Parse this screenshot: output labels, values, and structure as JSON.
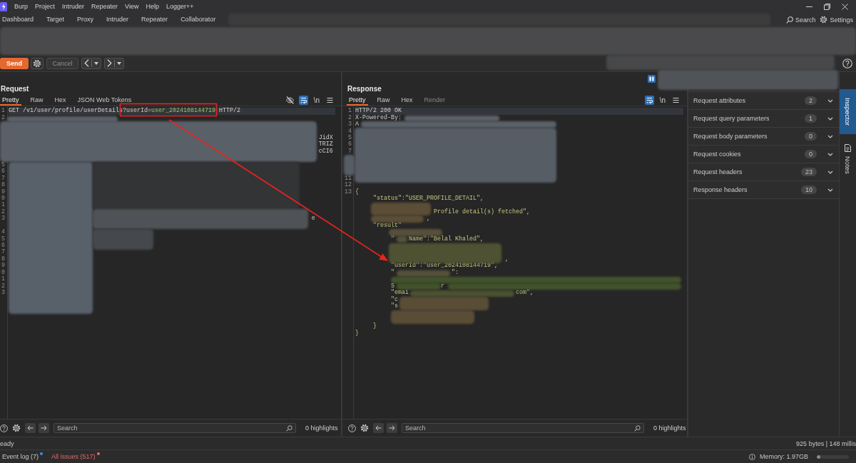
{
  "menu_bar": {
    "items": [
      "Burp",
      "Project",
      "Intruder",
      "Repeater",
      "View",
      "Help",
      "Logger++"
    ]
  },
  "nav": {
    "tabs": [
      {
        "label": "Dashboard",
        "selected": false
      },
      {
        "label": "Target",
        "selected": false
      },
      {
        "label": "Proxy",
        "selected": false
      },
      {
        "label": "Intruder",
        "selected": false
      },
      {
        "label": "Repeater",
        "selected": false
      },
      {
        "label": "Collaborator",
        "selected": false
      }
    ],
    "search": "Search",
    "settings": "Settings"
  },
  "toolbar": {
    "send": "Send",
    "cancel": {
      "label": "Cancel",
      "disabled": true
    }
  },
  "request": {
    "title": "Request",
    "tabs": [
      {
        "label": "Pretty",
        "selected": true,
        "disabled": false
      },
      {
        "label": "Raw",
        "selected": false,
        "disabled": false
      },
      {
        "label": "Hex",
        "selected": false,
        "disabled": false
      },
      {
        "label": "JSON Web Tokens",
        "selected": false,
        "disabled": false
      }
    ],
    "view_buttons": [
      {
        "kind": "hide",
        "on": false
      },
      {
        "kind": "wrap",
        "on": true
      },
      {
        "kind": "text",
        "label": "\\n",
        "on": false
      },
      {
        "kind": "menu",
        "on": false
      }
    ],
    "lines": [
      {
        "number": "1",
        "current": true,
        "segments": [
          {
            "kind": "plain",
            "text": "GET /v1/user/profile/userDetails"
          },
          {
            "kind": "param",
            "text": "?userId="
          },
          {
            "kind": "value",
            "text": "user_2024108144719"
          },
          {
            "kind": "plain",
            "text": " HTTP/2"
          }
        ]
      },
      {
        "number": "2",
        "current": false
      },
      {
        "current": false
      },
      {
        "current": false
      },
      {
        "current": false,
        "segments": [
          {
            "kind": "plain",
            "text": "                                                                                       JidX"
          }
        ]
      },
      {
        "current": false,
        "segments": [
          {
            "kind": "plain",
            "text": "                                                                                       TRIZ"
          }
        ]
      },
      {
        "current": false,
        "segments": [
          {
            "kind": "plain",
            "text": "                                                                                       cCI6"
          }
        ]
      },
      {
        "current": false
      },
      {
        "number": "5",
        "current": false
      },
      {
        "number": "6",
        "current": false
      },
      {
        "number": "7",
        "current": false
      },
      {
        "number": "8",
        "current": false
      },
      {
        "number": "9",
        "current": false
      },
      {
        "number": "0",
        "current": false
      },
      {
        "number": "1",
        "current": false
      },
      {
        "number": "2",
        "current": false
      },
      {
        "number": "3",
        "current": false,
        "segments": [
          {
            "kind": "plain",
            "text": "                                                                                     e"
          }
        ]
      },
      {
        "current": false
      },
      {
        "number": "4",
        "current": false
      },
      {
        "number": "5",
        "current": false
      },
      {
        "number": "6",
        "current": false
      },
      {
        "number": "7",
        "current": false
      },
      {
        "number": "8",
        "current": false
      },
      {
        "number": "9",
        "current": false
      },
      {
        "number": "0",
        "current": false
      },
      {
        "number": "1",
        "current": false
      },
      {
        "number": "2",
        "current": false
      },
      {
        "number": "3",
        "current": false
      }
    ],
    "search": {
      "placeholder": "Search"
    },
    "highlights": "0 highlights"
  },
  "response": {
    "title": "Response",
    "tabs": [
      {
        "label": "Pretty",
        "selected": true,
        "disabled": false
      },
      {
        "label": "Raw",
        "selected": false,
        "disabled": false
      },
      {
        "label": "Hex",
        "selected": false,
        "disabled": false
      },
      {
        "label": "Render",
        "selected": false,
        "disabled": true
      }
    ],
    "view_buttons": [
      {
        "kind": "wrap",
        "on": true
      },
      {
        "kind": "text",
        "label": "\\n",
        "on": false
      },
      {
        "kind": "menu",
        "on": false
      }
    ],
    "lines": [
      {
        "number": "1",
        "current": true,
        "segments": [
          {
            "kind": "plain",
            "text": "HTTP/2 200 OK"
          }
        ]
      },
      {
        "number": "2",
        "current": false,
        "segments": [
          {
            "kind": "plain",
            "text": "X-Powered-By:"
          }
        ]
      },
      {
        "number": "3",
        "current": false,
        "segments": [
          {
            "kind": "plain",
            "text": "A"
          }
        ]
      },
      {
        "number": "4",
        "current": false
      },
      {
        "number": "5",
        "current": false
      },
      {
        "number": "6",
        "current": false
      },
      {
        "number": "7",
        "current": false
      },
      {
        "current": false
      },
      {
        "current": false
      },
      {
        "current": false
      },
      {
        "number": "11",
        "current": false
      },
      {
        "number": "12",
        "current": false
      },
      {
        "number": "13",
        "current": false,
        "segments": [
          {
            "kind": "json",
            "text": "{"
          }
        ]
      },
      {
        "current": false,
        "segments": [
          {
            "kind": "json",
            "text": "     \"status\":\"USER_PROFILE_DETAIL\","
          }
        ]
      },
      {
        "current": false
      },
      {
        "current": false,
        "segments": [
          {
            "kind": "json",
            "text": "                      Profile detail(s) fetched\","
          }
        ]
      },
      {
        "current": false,
        "segments": [
          {
            "kind": "json",
            "text": "                    ,"
          }
        ]
      },
      {
        "current": false,
        "segments": [
          {
            "kind": "json",
            "text": "     \"result\""
          }
        ]
      },
      {
        "current": false
      },
      {
        "current": false,
        "segments": [
          {
            "kind": "json",
            "text": "          \""
          },
          {
            "kind": "json",
            "text": "    Name\":\"Belal Khaled\","
          }
        ]
      },
      {
        "current": false
      },
      {
        "current": false
      },
      {
        "current": false,
        "segments": [
          {
            "kind": "json",
            "text": "                                          ,"
          }
        ]
      },
      {
        "current": false,
        "segments": [
          {
            "kind": "json",
            "text": "          \"userId\":\"user_2024108144719\","
          }
        ]
      },
      {
        "current": false,
        "segments": [
          {
            "kind": "json",
            "text": "          \""
          },
          {
            "kind": "json",
            "text": "                \":"
          }
        ]
      },
      {
        "current": false
      },
      {
        "current": false,
        "segments": [
          {
            "kind": "json",
            "text": "          S"
          },
          {
            "kind": "json",
            "text": "             r"
          }
        ]
      },
      {
        "current": false,
        "segments": [
          {
            "kind": "json",
            "text": "          \"emai"
          },
          {
            "kind": "json",
            "text": "                              com\","
          }
        ]
      },
      {
        "current": false,
        "segments": [
          {
            "kind": "json",
            "text": "          \"c"
          }
        ]
      },
      {
        "current": false,
        "segments": [
          {
            "kind": "json",
            "text": "          \"s"
          }
        ]
      },
      {
        "current": false
      },
      {
        "current": false
      },
      {
        "current": false,
        "segments": [
          {
            "kind": "json",
            "text": "     }"
          }
        ]
      },
      {
        "current": false,
        "segments": [
          {
            "kind": "json",
            "text": "}"
          }
        ]
      }
    ],
    "search": {
      "placeholder": "Search"
    },
    "highlights": "0 highlights"
  },
  "inspector": {
    "sections": [
      {
        "label": "Request attributes",
        "count": "2",
        "expanded": false
      },
      {
        "label": "Request query parameters",
        "count": "1",
        "expanded": false
      },
      {
        "label": "Request body parameters",
        "count": "0",
        "expanded": false
      },
      {
        "label": "Request cookies",
        "count": "0",
        "expanded": false
      },
      {
        "label": "Request headers",
        "count": "23",
        "expanded": false
      },
      {
        "label": "Response headers",
        "count": "10",
        "expanded": false
      }
    ],
    "side_tabs": [
      {
        "label": "Inspector",
        "kind": "text",
        "selected": true
      },
      {
        "label": "Notes",
        "kind": "icon-text",
        "selected": false
      }
    ]
  },
  "status_bar": {
    "left": "eady",
    "right": "925 bytes | 148 millis"
  },
  "bottom_bar": {
    "items": [
      {
        "label": "Event log (7)",
        "color": "#3b8fe0",
        "alert": false
      },
      {
        "label": "All issues (517)",
        "color": "#e06a6a",
        "alert": true
      }
    ],
    "memory": {
      "label": "Memory: 1.97GB",
      "level": 0.1
    }
  }
}
